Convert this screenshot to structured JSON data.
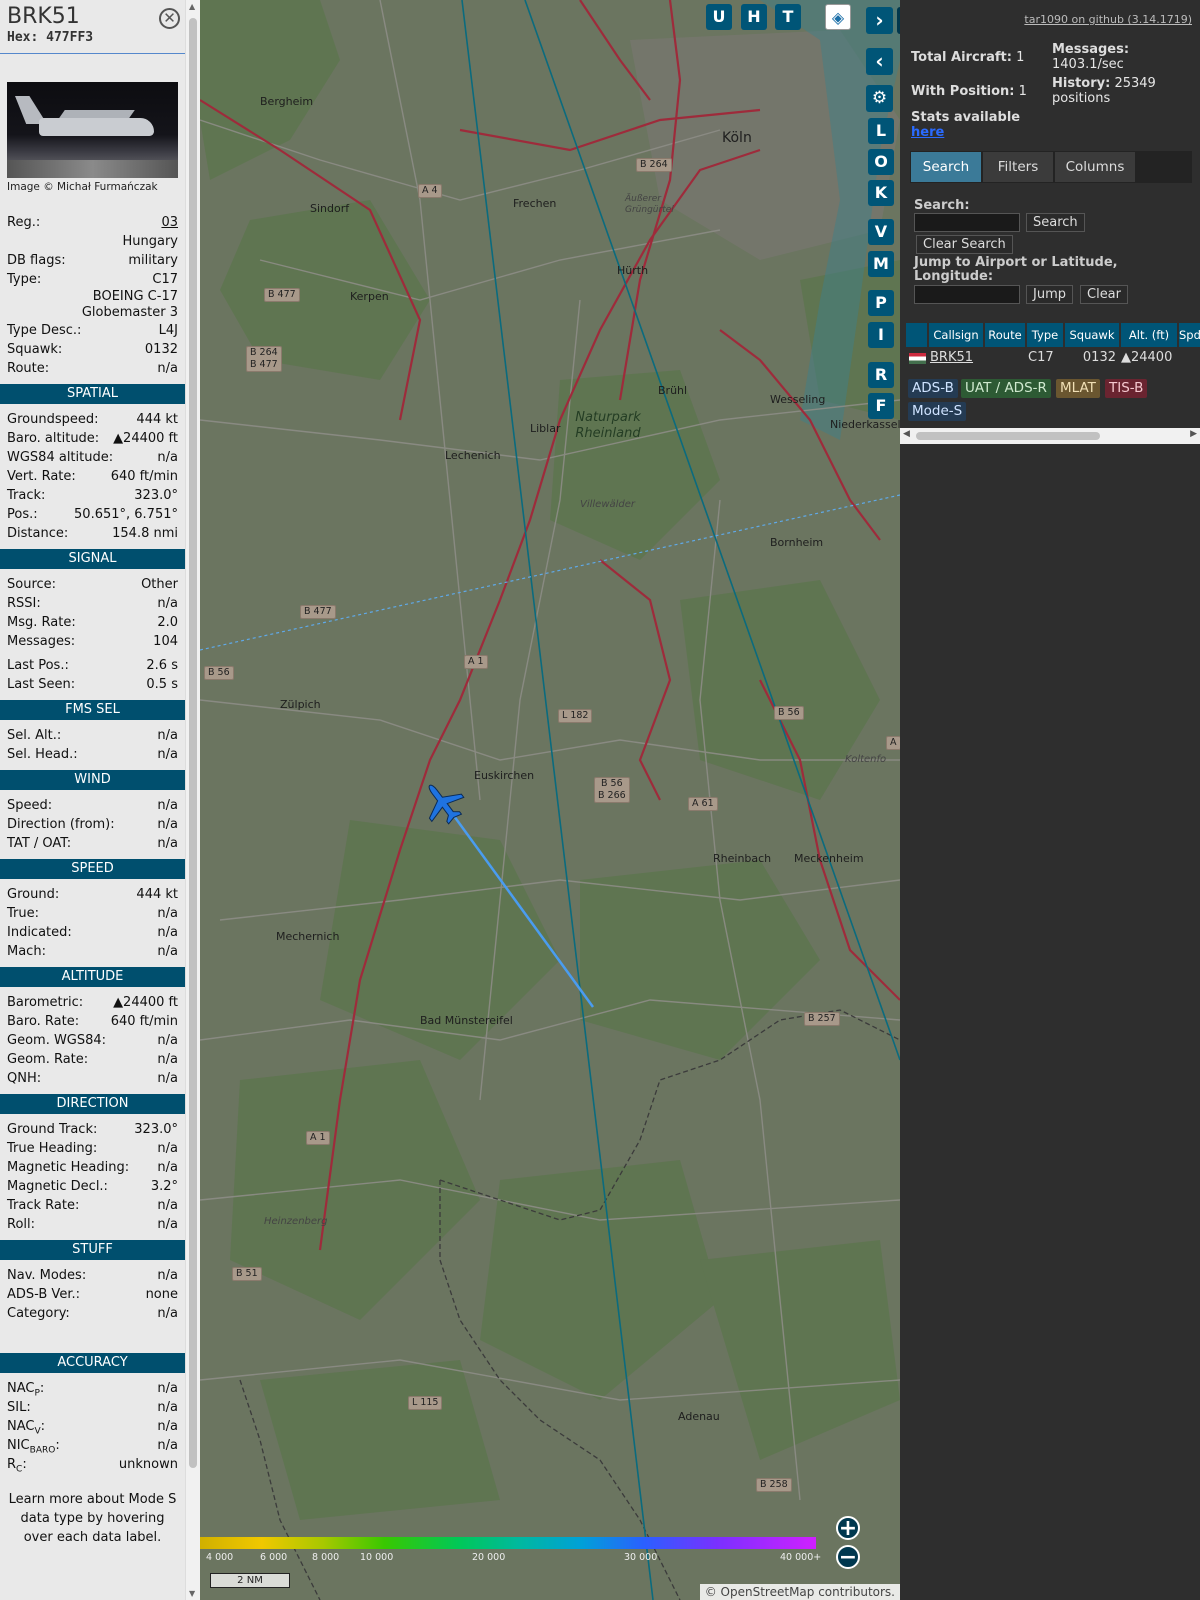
{
  "header": {
    "callsign": "BRK51",
    "hex_label": "Hex:",
    "hex": "477FF3"
  },
  "photo": {
    "credit": "Image © Michał Furmańczak"
  },
  "aircraft": [
    {
      "label": "Reg.:",
      "value": "03",
      "link": true
    },
    {
      "label": "",
      "value": "Hungary"
    },
    {
      "label": "DB flags:",
      "value": "military"
    },
    {
      "label": "Type:",
      "value": "C17"
    },
    {
      "label": "",
      "value": "BOEING C-17"
    },
    {
      "label": "",
      "value": "Globemaster 3"
    },
    {
      "label": "Type Desc.:",
      "value": "L4J"
    },
    {
      "label": "Squawk:",
      "value": "0132"
    },
    {
      "label": "Route:",
      "value": "n/a"
    }
  ],
  "sections": [
    {
      "title": "SPATIAL",
      "rows": [
        [
          "Groundspeed:",
          "444 kt"
        ],
        [
          "Baro. altitude:",
          "▲24400 ft"
        ],
        [
          "WGS84 altitude:",
          "n/a"
        ],
        [
          "Vert. Rate:",
          "640 ft/min"
        ],
        [
          "Track:",
          "323.0°"
        ],
        [
          "Pos.:",
          "50.651°, 6.751°"
        ],
        [
          "Distance:",
          "154.8 nmi"
        ]
      ]
    },
    {
      "title": "SIGNAL",
      "rows": [
        [
          "Source:",
          "Other"
        ],
        [
          "RSSI:",
          "n/a"
        ],
        [
          "Msg. Rate:",
          "2.0"
        ],
        [
          "Messages:",
          "104"
        ],
        [
          "Last Pos.:",
          "2.6 s"
        ],
        [
          "Last Seen:",
          "0.5 s"
        ]
      ]
    },
    {
      "title": "FMS SEL",
      "rows": [
        [
          "Sel. Alt.:",
          "n/a"
        ],
        [
          "Sel. Head.:",
          "n/a"
        ]
      ]
    },
    {
      "title": "WIND",
      "rows": [
        [
          "Speed:",
          "n/a"
        ],
        [
          "Direction (from):",
          "n/a"
        ],
        [
          "TAT / OAT:",
          "n/a"
        ]
      ]
    },
    {
      "title": "SPEED",
      "rows": [
        [
          "Ground:",
          "444 kt"
        ],
        [
          "True:",
          "n/a"
        ],
        [
          "Indicated:",
          "n/a"
        ],
        [
          "Mach:",
          "n/a"
        ]
      ]
    },
    {
      "title": "ALTITUDE",
      "rows": [
        [
          "Barometric:",
          "▲24400 ft"
        ],
        [
          "Baro. Rate:",
          "640 ft/min"
        ],
        [
          "Geom. WGS84:",
          "n/a"
        ],
        [
          "Geom. Rate:",
          "n/a"
        ],
        [
          "QNH:",
          "n/a"
        ]
      ]
    },
    {
      "title": "DIRECTION",
      "rows": [
        [
          "Ground Track:",
          "323.0°"
        ],
        [
          "True Heading:",
          "n/a"
        ],
        [
          "Magnetic Heading:",
          "n/a"
        ],
        [
          "Magnetic Decl.:",
          "3.2°"
        ],
        [
          "Track Rate:",
          "n/a"
        ],
        [
          "Roll:",
          "n/a"
        ]
      ]
    },
    {
      "title": "STUFF",
      "rows": [
        [
          "Nav. Modes:",
          "n/a"
        ],
        [
          "ADS-B Ver.:",
          "none"
        ],
        [
          "Category:",
          "n/a"
        ]
      ]
    },
    {
      "title": "ACCURACY",
      "rows": [
        [
          "NACP:",
          "n/a"
        ],
        [
          "SIL:",
          "n/a"
        ],
        [
          "NACV:",
          "n/a"
        ],
        [
          "NICBARO:",
          "n/a"
        ],
        [
          "RC:",
          "unknown"
        ]
      ]
    }
  ],
  "accuracy_labels": [
    {
      "base": "NAC",
      "sub": "P"
    },
    {
      "base": "SIL:",
      "sub": ""
    },
    {
      "base": "NAC",
      "sub": "V"
    },
    {
      "base": "NIC",
      "sub": "BARO"
    },
    {
      "base": "R",
      "sub": "C"
    }
  ],
  "footnote": "Learn more about Mode S data type by hovering over each data label.",
  "map": {
    "top_buttons": [
      "U",
      "H",
      "T"
    ],
    "side_buttons": [
      "L",
      "O",
      "K",
      "V",
      "M",
      "P",
      "I",
      "R",
      "F"
    ],
    "attribution": "© OpenStreetMap contributors.",
    "scale": "2 NM",
    "legend": [
      "4 000",
      "6 000",
      "8 000",
      "10 000",
      "20 000",
      "30 000",
      "40 000+"
    ],
    "towns": [
      "Bergheim",
      "Köln",
      "Sindorf",
      "Frechen",
      "Kerpen",
      "Hürth",
      "Brühl",
      "Wesseling",
      "Niederkassel",
      "Lechenich",
      "Liblar",
      "Bornheim",
      "Zülpich",
      "Euskirchen",
      "Rheinbach",
      "Meckenheim",
      "Mechernich",
      "Bad Münstereifel",
      "Adenau",
      "Heinzenberg",
      "Koltenfo",
      "Villewälder"
    ],
    "park": "Naturpark Rheinland",
    "park_small": "Äußerer Grüngürtel",
    "shields": [
      "B 264",
      "A 4",
      "B 477",
      "B 264\nB 477",
      "B 477",
      "B 56",
      "A 1",
      "L 182",
      "B 56\nB 266",
      "A 61",
      "B 56",
      "B 257",
      "A 1",
      "B 51",
      "L 115",
      "B 258",
      "A"
    ]
  },
  "sidebar": {
    "github": "tar1090 on github (3.14.1719)",
    "total_label": "Total Aircraft:",
    "total": "1",
    "pos_label": "With Position:",
    "pos": "1",
    "messages_label": "Messages:",
    "messages": "1403.1/sec",
    "history_label": "History:",
    "history": "25349 positions",
    "stats_label": "Stats available",
    "stats_link": "here",
    "tabs": [
      "Search",
      "Filters",
      "Columns"
    ],
    "search_label": "Search:",
    "search_btn": "Search",
    "clear_search": "Clear Search",
    "jump_label": "Jump to Airport or Latitude, Longitude:",
    "jump_btn": "Jump",
    "clear_btn": "Clear",
    "columns": [
      "Callsign",
      "Route",
      "Type",
      "Squawk",
      "Alt. (ft)",
      "Spd"
    ],
    "row": {
      "callsign": "BRK51",
      "route": "",
      "type": "C17",
      "squawk": "0132",
      "alt": "▲24400"
    },
    "badges": [
      "ADS-B",
      "UAT / ADS-R",
      "MLAT",
      "TIS-B",
      "Mode-S"
    ]
  }
}
